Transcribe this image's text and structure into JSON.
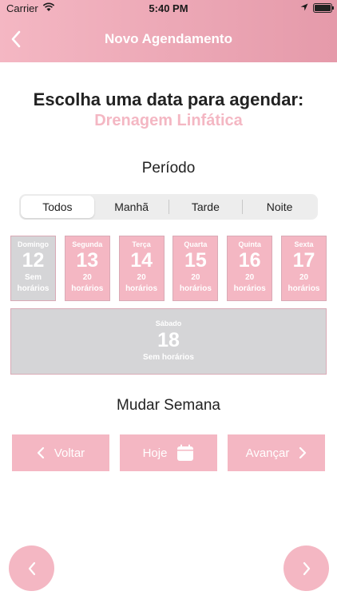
{
  "status_bar": {
    "carrier": "Carrier",
    "time": "5:40 PM"
  },
  "header": {
    "title": "Novo Agendamento"
  },
  "main": {
    "title": "Escolha uma data para agendar:",
    "service": "Drenagem Linfática",
    "period_label": "Período",
    "periods": [
      {
        "label": "Todos",
        "selected": true
      },
      {
        "label": "Manhã",
        "selected": false
      },
      {
        "label": "Tarde",
        "selected": false
      },
      {
        "label": "Noite",
        "selected": false
      }
    ],
    "days": [
      {
        "name": "Domingo",
        "number": "12",
        "line1": "Sem",
        "line2": "horários",
        "available": false
      },
      {
        "name": "Segunda",
        "number": "13",
        "line1": "20",
        "line2": "horários",
        "available": true
      },
      {
        "name": "Terça",
        "number": "14",
        "line1": "20",
        "line2": "horários",
        "available": true
      },
      {
        "name": "Quarta",
        "number": "15",
        "line1": "20",
        "line2": "horários",
        "available": true
      },
      {
        "name": "Quinta",
        "number": "16",
        "line1": "20",
        "line2": "horários",
        "available": true
      },
      {
        "name": "Sexta",
        "number": "17",
        "line1": "20",
        "line2": "horários",
        "available": true
      }
    ],
    "saturday": {
      "name": "Sábado",
      "number": "18",
      "status": "Sem horários",
      "available": false
    },
    "change_week_label": "Mudar Semana",
    "week_nav": {
      "back": "Voltar",
      "today": "Hoje",
      "forward": "Avançar"
    }
  },
  "colors": {
    "accent": "#f4b7c3",
    "unavailable": "#d5d5d7"
  }
}
